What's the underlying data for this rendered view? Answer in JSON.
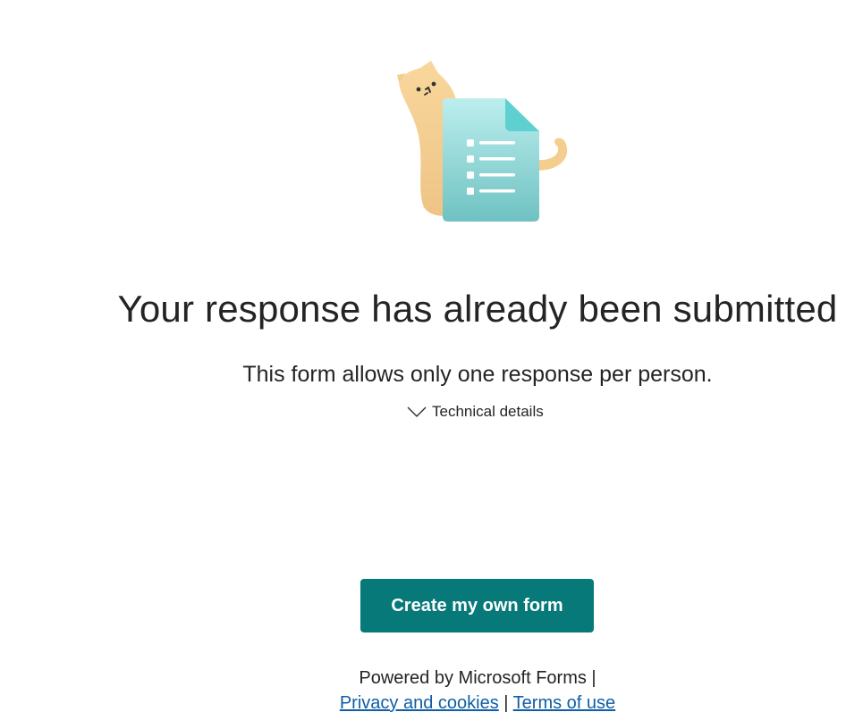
{
  "illustration": {
    "icon": "cat-with-form-icon",
    "colors": {
      "cat": "#f5cd8c",
      "form_light": "#b9ecec",
      "form_dark": "#73c3c3",
      "fold": "#5fd0d0"
    }
  },
  "message": {
    "title": "Your response has already been submitted",
    "subtitle": "This form allows only one response per person.",
    "technical_details_label": "Technical details",
    "technical_details_icon": "chevron-down-icon"
  },
  "actions": {
    "create_form_label": "Create my own form",
    "accent_color": "#077979"
  },
  "footer": {
    "powered_by": "Powered by Microsoft Forms |",
    "privacy_label": "Privacy and cookies",
    "separator": "|",
    "terms_label": "Terms of use",
    "link_color": "#0f5fa6"
  }
}
